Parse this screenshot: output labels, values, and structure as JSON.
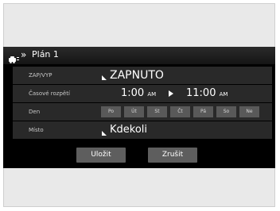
{
  "header": {
    "chevron": "»",
    "title": "Plán 1",
    "icon": "car-icon"
  },
  "rows": {
    "onoff": {
      "label": "ZAP/VYP",
      "value": "ZAPNUTO"
    },
    "timer": {
      "label": "Časové rozpětí",
      "start": "1:00",
      "start_ampm": "AM",
      "end": "11:00",
      "end_ampm": "AM"
    },
    "days": {
      "label": "Den",
      "items": [
        "Po",
        "Út",
        "St",
        "Čt",
        "Pá",
        "So",
        "Ne"
      ]
    },
    "place": {
      "label": "Místo",
      "value": "Kdekoli"
    }
  },
  "buttons": {
    "save": "Uložit",
    "cancel": "Zrušit"
  },
  "colors": {
    "screen_bg": "#000000",
    "row_bg": "#292929",
    "button_bg": "#5e5e5e"
  }
}
